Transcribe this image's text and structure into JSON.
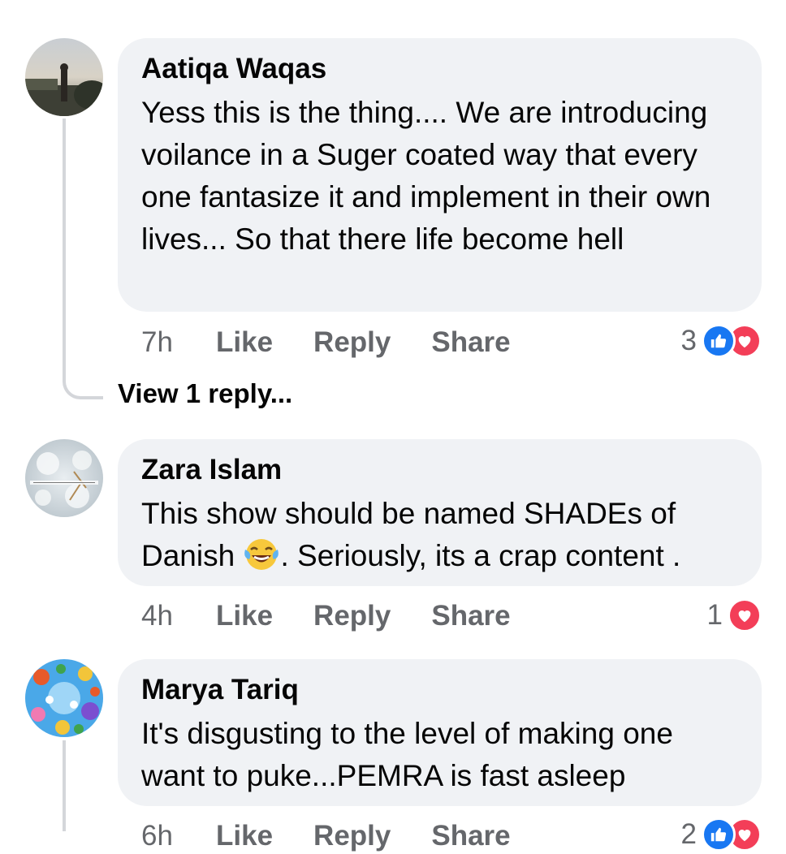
{
  "comments": [
    {
      "author": "Aatiqa Waqas",
      "text": "Yess this is the thing.... We are introducing voilance in a Suger coated way that every one fantasize it  and implement in their own lives... So that there life become hell",
      "time": "7h",
      "like_label": "Like",
      "reply_label": "Reply",
      "share_label": "Share",
      "reaction_count": "3",
      "reactions": [
        "like-icon",
        "love-icon"
      ],
      "view_replies_label": "View 1 reply..."
    },
    {
      "author": "Zara Islam",
      "text_before": "This show should be named SHADEs of Danish ",
      "emoji": "laughing-tears-emoji",
      "text_after": ". Seriously, its a crap content .",
      "time": "4h",
      "like_label": "Like",
      "reply_label": "Reply",
      "share_label": "Share",
      "reaction_count": "1",
      "reactions": [
        "love-icon"
      ]
    },
    {
      "author": "Marya Tariq",
      "text": "It's disgusting to the level of making one want to puke...PEMRA is fast asleep",
      "time": "6h",
      "like_label": "Like",
      "reply_label": "Reply",
      "share_label": "Share",
      "reaction_count": "2",
      "reactions": [
        "like-icon",
        "love-icon"
      ]
    }
  ],
  "colors": {
    "bubble": "#f0f2f5",
    "secondary_text": "#65676b",
    "like_blue": "#1877f2",
    "love_red": "#f33e58",
    "thread_line": "#d4d6da"
  }
}
